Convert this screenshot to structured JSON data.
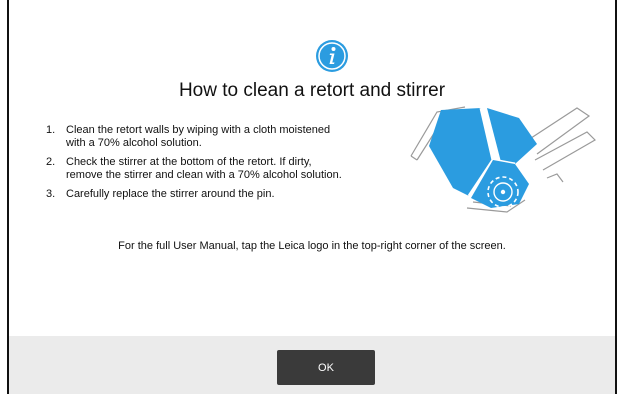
{
  "dialog": {
    "title": "How to clean a retort and stirrer",
    "icon": "info-icon",
    "accent_color": "#2b9ce0",
    "steps": [
      {
        "number": "1.",
        "text": "Clean the retort walls by wiping with a cloth moistened with a 70% alcohol solution."
      },
      {
        "number": "2.",
        "text": "Check the stirrer at the bottom of the retort. If dirty, remove the stirrer and clean with a 70% alcohol solution."
      },
      {
        "number": "3.",
        "text": "Carefully replace the stirrer around the pin."
      }
    ],
    "manual_note": "For the full User Manual, tap the Leica logo in the top-right corner of the screen.",
    "ok_label": "OK"
  }
}
